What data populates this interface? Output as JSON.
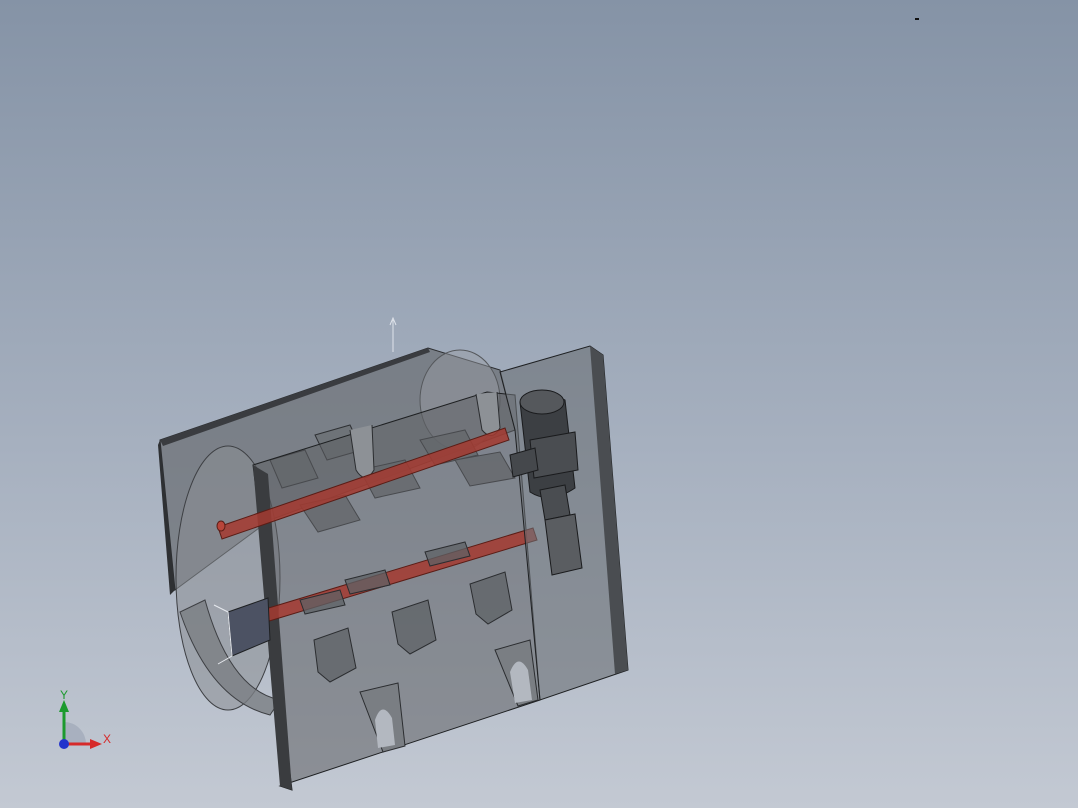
{
  "viewport": {
    "background_top": "#8593a6",
    "background_bottom": "#c3c9d3"
  },
  "model": {
    "icon": "mixer-machine-assembly-icon",
    "shaft_color": "#a43a30",
    "housing_color": "#5e6165",
    "rendering": "shaded-transparent"
  },
  "triad": {
    "y_label": "Y",
    "x_label": "X",
    "y_color": "#1c9a2e",
    "x_color": "#d62a2a",
    "z_color": "#2233cc"
  }
}
